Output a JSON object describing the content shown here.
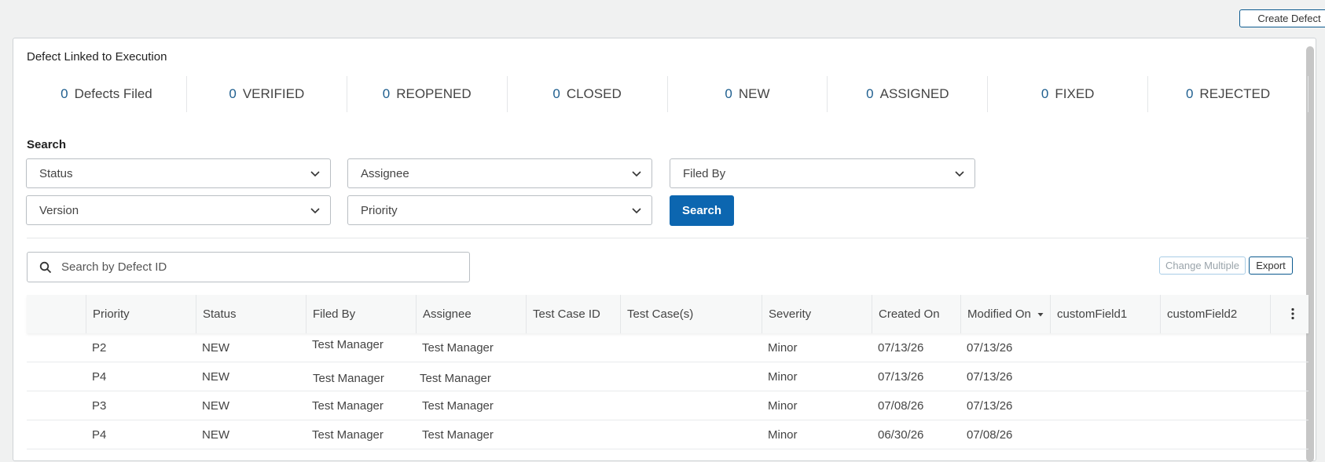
{
  "toolbar": {
    "create_defect_label": "Create Defect"
  },
  "panel": {
    "title": "Defect Linked to Execution",
    "stats": [
      {
        "count": "0",
        "label": "Defects Filed"
      },
      {
        "count": "0",
        "label": "VERIFIED"
      },
      {
        "count": "0",
        "label": "REOPENED"
      },
      {
        "count": "0",
        "label": "CLOSED"
      },
      {
        "count": "0",
        "label": "NEW"
      },
      {
        "count": "0",
        "label": "ASSIGNED"
      },
      {
        "count": "0",
        "label": "FIXED"
      },
      {
        "count": "0",
        "label": "REJECTED"
      }
    ]
  },
  "filters": {
    "section_label": "Search",
    "status_placeholder": "Status",
    "assignee_placeholder": "Assignee",
    "filed_by_placeholder": "Filed By",
    "version_placeholder": "Version",
    "priority_placeholder": "Priority",
    "search_button_label": "Search"
  },
  "defect_search": {
    "placeholder": "Search by Defect ID"
  },
  "table_actions": {
    "change_multiple_label": "Change Multiple",
    "export_label": "Export"
  },
  "table": {
    "columns": [
      "",
      "Priority",
      "Status",
      "Filed By",
      "Assignee",
      "Test Case ID",
      "Test Case(s)",
      "Severity",
      "Created On",
      "Modified On",
      "customField1",
      "customField2"
    ],
    "sorted_column": "Modified On",
    "rows": [
      {
        "priority": "P2",
        "status": "NEW",
        "filed_by": "Test Manager",
        "assignee": "Test Manager",
        "test_case_id": "",
        "test_cases": "",
        "severity": "Minor",
        "created_on": "07/13/26",
        "modified_on": "07/13/26",
        "custom1": "",
        "custom2": ""
      },
      {
        "priority": "P4",
        "status": "NEW",
        "filed_by": "Test Manager",
        "assignee": "Test Manager",
        "test_case_id": "",
        "test_cases": "",
        "severity": "Minor",
        "created_on": "07/13/26",
        "modified_on": "07/13/26",
        "custom1": "",
        "custom2": ""
      },
      {
        "priority": "P3",
        "status": "NEW",
        "filed_by": "Test Manager",
        "assignee": "Test Manager",
        "test_case_id": "",
        "test_cases": "",
        "severity": "Minor",
        "created_on": "07/08/26",
        "modified_on": "07/13/26",
        "custom1": "",
        "custom2": ""
      },
      {
        "priority": "P4",
        "status": "NEW",
        "filed_by": "Test Manager",
        "assignee": "Test Manager",
        "test_case_id": "",
        "test_cases": "",
        "severity": "Minor",
        "created_on": "06/30/26",
        "modified_on": "07/08/26",
        "custom1": "",
        "custom2": ""
      }
    ]
  },
  "colors": {
    "accent": "#0c66b0",
    "count_text": "#1f5f8f"
  },
  "icons": [
    "chevron-down-icon",
    "search-icon",
    "sort-down-icon",
    "more-options-icon"
  ]
}
